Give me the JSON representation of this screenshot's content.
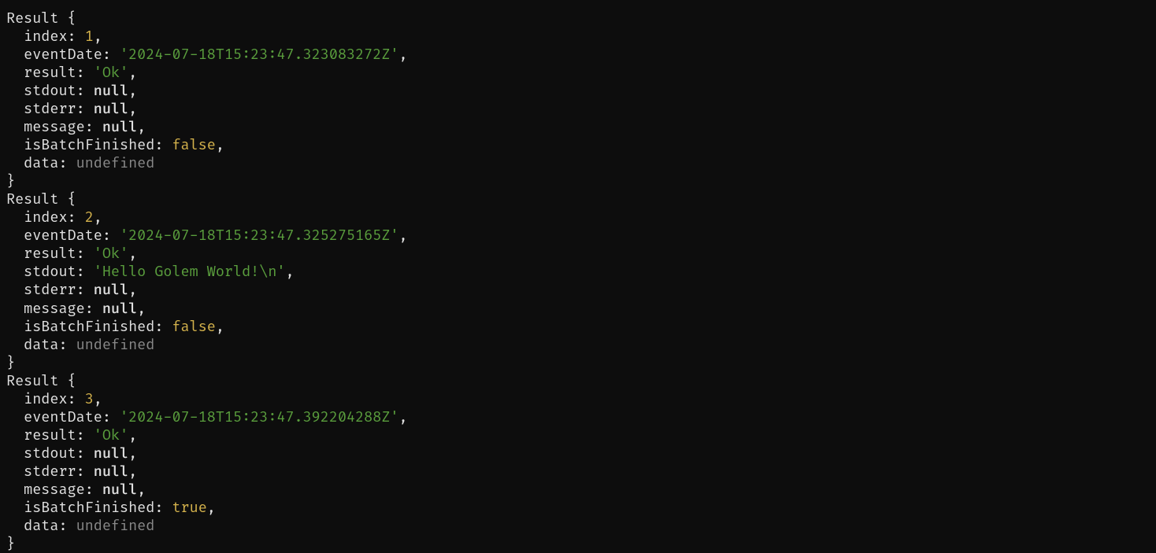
{
  "results": [
    {
      "typeName": "Result",
      "index": 1,
      "eventDate": "'2024-07-18T15:23:47.323083272Z'",
      "result": "'Ok'",
      "stdout": "null",
      "stderr": "null",
      "message": "null",
      "isBatchFinished": "false",
      "data": "undefined"
    },
    {
      "typeName": "Result",
      "index": 2,
      "eventDate": "'2024-07-18T15:23:47.325275165Z'",
      "result": "'Ok'",
      "stdout": "'Hello Golem World!\\n'",
      "stderr": "null",
      "message": "null",
      "isBatchFinished": "false",
      "data": "undefined"
    },
    {
      "typeName": "Result",
      "index": 3,
      "eventDate": "'2024-07-18T15:23:47.392204288Z'",
      "result": "'Ok'",
      "stdout": "null",
      "stderr": "null",
      "message": "null",
      "isBatchFinished": "true",
      "data": "undefined"
    }
  ],
  "labels": {
    "index": "index",
    "eventDate": "eventDate",
    "result": "result",
    "stdout": "stdout",
    "stderr": "stderr",
    "message": "message",
    "isBatchFinished": "isBatchFinished",
    "data": "data"
  }
}
